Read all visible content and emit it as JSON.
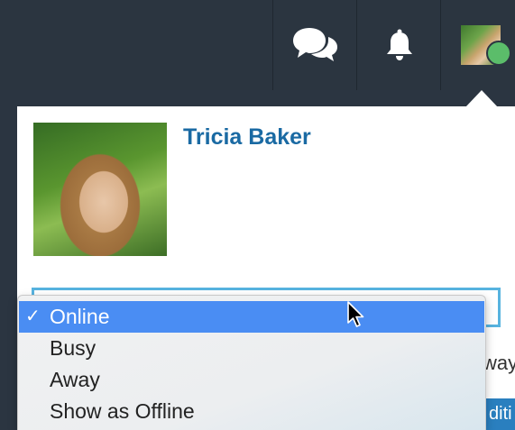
{
  "header": {
    "chat_icon": "chat-bubbles-icon",
    "bell_icon": "bell-icon",
    "status_color": "#5bbd6a"
  },
  "profile": {
    "name": "Tricia Baker"
  },
  "status_menu": {
    "items": [
      {
        "label": "Online",
        "selected": true
      },
      {
        "label": "Busy",
        "selected": false
      },
      {
        "label": "Away",
        "selected": false
      },
      {
        "label": "Show as Offline",
        "selected": false
      }
    ],
    "check_mark": "✓",
    "selected_color": "#4a8df3"
  },
  "background": {
    "partial_text": "way",
    "partial_button": "diti"
  }
}
